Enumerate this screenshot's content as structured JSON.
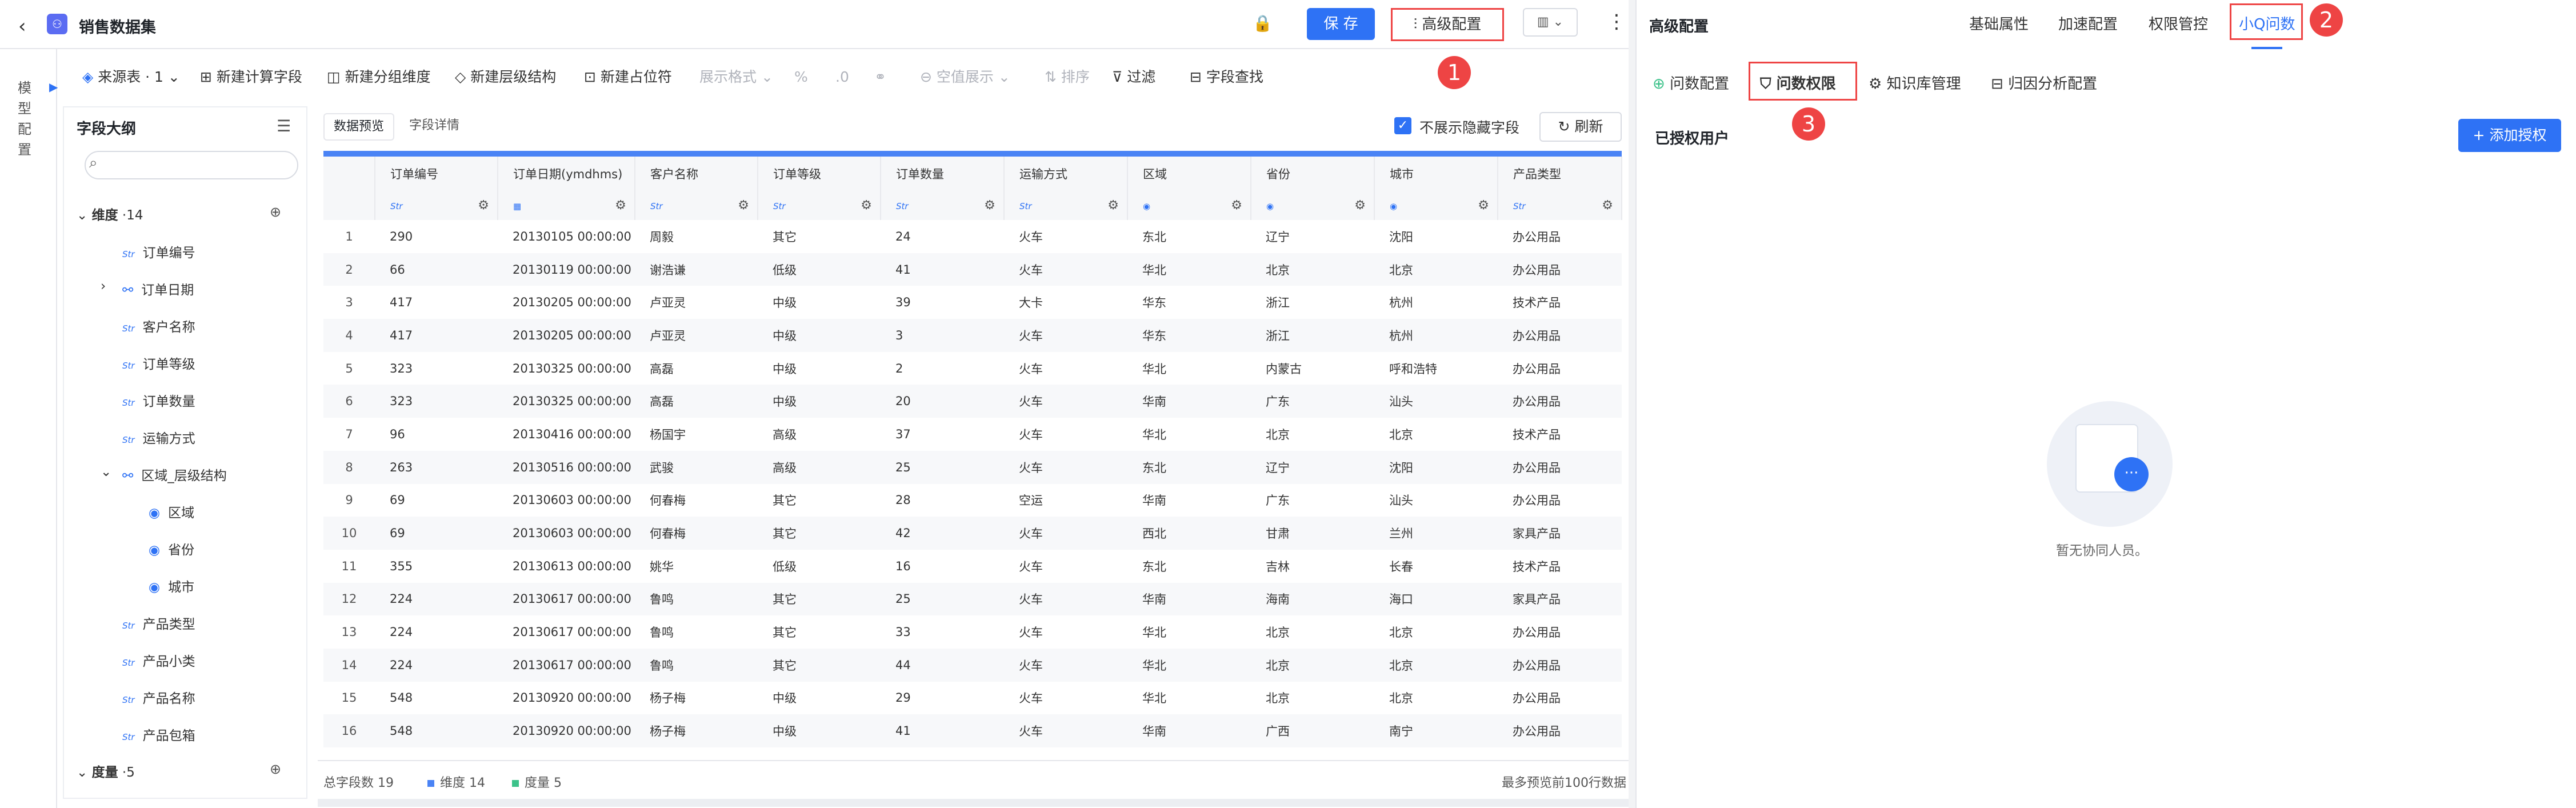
{
  "header": {
    "back_icon": "‹",
    "title": "销售数据集",
    "save_label": "保 存",
    "advanced_label": "高级配置",
    "kebab": "⋮"
  },
  "toolbar": {
    "source": "来源表 · 1",
    "add_calc": "新建计算字段",
    "add_group": "新建分组维度",
    "add_hier": "新建层级结构",
    "add_placeholder": "新建占位符",
    "display_format": "展示格式",
    "null_display": "空值展示",
    "sort": "排序",
    "filter": "过滤",
    "field_search": "字段查找"
  },
  "rail": {
    "label": "模型配置"
  },
  "outline": {
    "title": "字段大纲",
    "dimensions": "维度",
    "dim_count": "·14",
    "measures": "度量",
    "measure_count": "·5",
    "items": [
      {
        "type": "Str",
        "label": "订单编号"
      },
      {
        "type": "time",
        "label": "订单日期"
      },
      {
        "type": "Str",
        "label": "客户名称"
      },
      {
        "type": "Str",
        "label": "订单等级"
      },
      {
        "type": "Str",
        "label": "订单数量"
      },
      {
        "type": "Str",
        "label": "运输方式"
      },
      {
        "type": "hier",
        "label": "区域_层级结构"
      },
      {
        "type": "geo",
        "label": "区域"
      },
      {
        "type": "geo",
        "label": "省份"
      },
      {
        "type": "geo",
        "label": "城市"
      },
      {
        "type": "Str",
        "label": "产品类型"
      },
      {
        "type": "Str",
        "label": "产品小类"
      },
      {
        "type": "Str",
        "label": "产品名称"
      },
      {
        "type": "Str",
        "label": "产品包箱"
      }
    ]
  },
  "grid": {
    "tab_preview": "数据预览",
    "tab_detail": "字段详情",
    "hide_label": "不展示隐藏字段",
    "refresh": "刷新",
    "columns": [
      "订单编号",
      "订单日期(ymdhms)",
      "客户名称",
      "订单等级",
      "订单数量",
      "运输方式",
      "区域",
      "省份",
      "城市",
      "产品类型"
    ],
    "col_types": [
      "Str",
      "date",
      "Str",
      "Str",
      "Str",
      "Str",
      "geo",
      "geo",
      "geo",
      "Str"
    ],
    "rows": [
      [
        "1",
        "290",
        "20130105 00:00:00",
        "周毅",
        "其它",
        "24",
        "火车",
        "东北",
        "辽宁",
        "沈阳",
        "办公用品"
      ],
      [
        "2",
        "66",
        "20130119 00:00:00",
        "谢浩谦",
        "低级",
        "41",
        "火车",
        "华北",
        "北京",
        "北京",
        "办公用品"
      ],
      [
        "3",
        "417",
        "20130205 00:00:00",
        "卢亚灵",
        "中级",
        "39",
        "大卡",
        "华东",
        "浙江",
        "杭州",
        "技术产品"
      ],
      [
        "4",
        "417",
        "20130205 00:00:00",
        "卢亚灵",
        "中级",
        "3",
        "火车",
        "华东",
        "浙江",
        "杭州",
        "办公用品"
      ],
      [
        "5",
        "323",
        "20130325 00:00:00",
        "高磊",
        "中级",
        "2",
        "火车",
        "华北",
        "内蒙古",
        "呼和浩特",
        "办公用品"
      ],
      [
        "6",
        "323",
        "20130325 00:00:00",
        "高磊",
        "中级",
        "20",
        "火车",
        "华南",
        "广东",
        "汕头",
        "办公用品"
      ],
      [
        "7",
        "96",
        "20130416 00:00:00",
        "杨国宇",
        "高级",
        "37",
        "火车",
        "华北",
        "北京",
        "北京",
        "技术产品"
      ],
      [
        "8",
        "263",
        "20130516 00:00:00",
        "武骏",
        "高级",
        "25",
        "火车",
        "东北",
        "辽宁",
        "沈阳",
        "办公用品"
      ],
      [
        "9",
        "69",
        "20130603 00:00:00",
        "何春梅",
        "其它",
        "28",
        "空运",
        "华南",
        "广东",
        "汕头",
        "办公用品"
      ],
      [
        "10",
        "69",
        "20130603 00:00:00",
        "何春梅",
        "其它",
        "42",
        "火车",
        "西北",
        "甘肃",
        "兰州",
        "家具产品"
      ],
      [
        "11",
        "355",
        "20130613 00:00:00",
        "姚华",
        "低级",
        "16",
        "火车",
        "东北",
        "吉林",
        "长春",
        "技术产品"
      ],
      [
        "12",
        "224",
        "20130617 00:00:00",
        "鲁鸣",
        "其它",
        "25",
        "火车",
        "华南",
        "海南",
        "海口",
        "家具产品"
      ],
      [
        "13",
        "224",
        "20130617 00:00:00",
        "鲁鸣",
        "其它",
        "33",
        "火车",
        "华北",
        "北京",
        "北京",
        "办公用品"
      ],
      [
        "14",
        "224",
        "20130617 00:00:00",
        "鲁鸣",
        "其它",
        "44",
        "火车",
        "华北",
        "北京",
        "北京",
        "办公用品"
      ],
      [
        "15",
        "548",
        "20130920 00:00:00",
        "杨子梅",
        "中级",
        "29",
        "火车",
        "华北",
        "北京",
        "北京",
        "办公用品"
      ],
      [
        "16",
        "548",
        "20130920 00:00:00",
        "杨子梅",
        "中级",
        "41",
        "火车",
        "华南",
        "广西",
        "南宁",
        "办公用品"
      ]
    ]
  },
  "footer": {
    "total": "总字段数 19",
    "dims": "维度 14",
    "measures": "度量 5",
    "note": "最多预览前100行数据",
    "dim_color": "#4a83f5",
    "measure_color": "#3cc28a"
  },
  "panel": {
    "title": "高级配置",
    "tabs": [
      "基础属性",
      "加速配置",
      "权限管控",
      "小Q问数"
    ],
    "subtabs": [
      "问数配置",
      "问数权限",
      "知识库管理",
      "归因分析配置"
    ],
    "users_title": "已授权用户",
    "add_btn": "+ 添加授权",
    "empty_text": "暂无协同人员。"
  },
  "markers": [
    "1",
    "2",
    "3"
  ],
  "colors": {
    "accent": "#2e72f5",
    "highlight": "#e44444"
  }
}
